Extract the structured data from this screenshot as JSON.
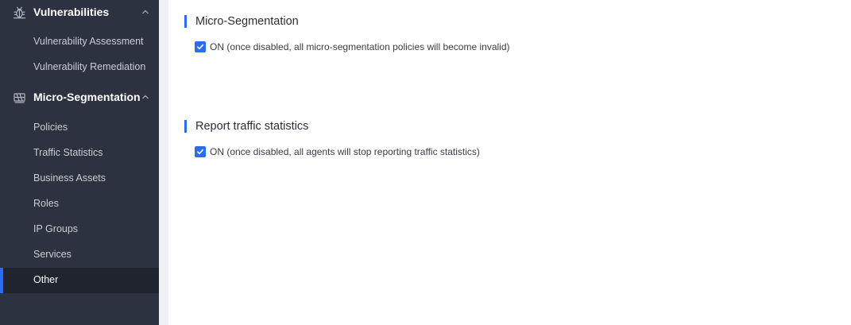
{
  "sidebar": {
    "groups": [
      {
        "label": "Vulnerabilities",
        "icon": "bug-icon",
        "expanded": true,
        "items": [
          {
            "label": "Vulnerability Assessment"
          },
          {
            "label": "Vulnerability Remediation"
          }
        ]
      },
      {
        "label": "Micro-Segmentation",
        "icon": "segmentation-icon",
        "expanded": true,
        "items": [
          {
            "label": "Policies"
          },
          {
            "label": "Traffic Statistics"
          },
          {
            "label": "Business Assets"
          },
          {
            "label": "Roles"
          },
          {
            "label": "IP Groups"
          },
          {
            "label": "Services"
          },
          {
            "label": "Other",
            "active": true
          }
        ]
      }
    ]
  },
  "main": {
    "sections": [
      {
        "title": "Micro-Segmentation",
        "checkbox_label": "ON (once disabled, all micro-segmentation policies will become invalid)",
        "checked": true
      },
      {
        "title": "Report traffic statistics",
        "checkbox_label": "ON (once disabled, all agents will stop reporting traffic statistics)",
        "checked": true
      }
    ]
  },
  "colors": {
    "sidebar_bg": "#2c323f",
    "sidebar_active_bg": "#20242e",
    "accent": "#2a6df4",
    "gutter": "#eff1f5"
  }
}
